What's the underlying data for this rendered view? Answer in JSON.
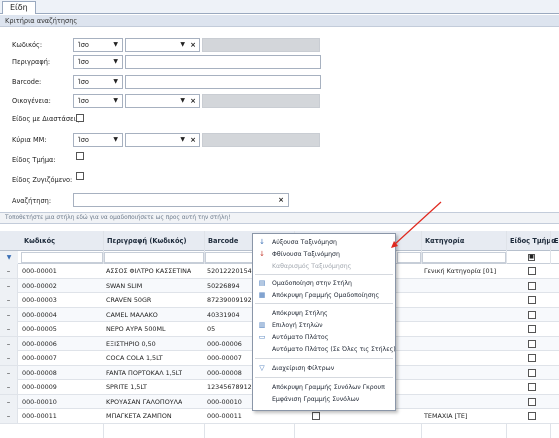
{
  "tab": {
    "label": "Είδη"
  },
  "criteria": {
    "header": "Κριτήρια αναζήτησης",
    "code_label": "Κωδικός:",
    "code_op": "Ίσο",
    "desc_label": "Περιγραφή:",
    "desc_op": "Ίσο",
    "barcode_label": "Barcode:",
    "barcode_op": "Ίσο",
    "family_label": "Οικογένεια:",
    "family_op": "Ίσο",
    "dimensions_label": "Είδος με Διαστάσεις:",
    "unit_label": "Κύρια ΜΜ:",
    "unit_op": "Ίσο",
    "part_label": "Είδος Τμήμα:",
    "weighed_label": "Είδος Ζυγιζόμενο:",
    "search_label": "Αναζήτηση:",
    "search_value": ""
  },
  "grid": {
    "group_hint": "Τοποθετήστε μια στήλη εδώ για να ομαδοποιήσετε ως προς αυτή την στήλη!",
    "columns": [
      "Κωδικός",
      "Περιγραφή (Κωδικός)",
      "Barcode",
      "",
      "Κατηγορία",
      "Είδος Τμήμα",
      "Ε"
    ],
    "rows": [
      {
        "code": "000-00001",
        "desc": "ΑΣΣΟΣ ΦΙΛΤΡΟ ΚΑΣΣΕΤΙΝΑ",
        "barcode": "5201222015413",
        "cat": "Γενική Κατηγορία [01]"
      },
      {
        "code": "000-00002",
        "desc": "SWAN SLIM",
        "barcode": "50226894",
        "cat": ""
      },
      {
        "code": "000-00003",
        "desc": "CRAVEN 50GR",
        "barcode": "8723900919259",
        "cat": ""
      },
      {
        "code": "000-00004",
        "desc": "CAMEL ΜΑΛΑΚΟ",
        "barcode": "40331904",
        "cat": ""
      },
      {
        "code": "000-00005",
        "desc": "ΝΕΡΟ ΑΥΡΑ 500ML",
        "barcode": "05",
        "cat": ""
      },
      {
        "code": "000-00006",
        "desc": "ΕΞΙΣΤΗΡΙΟ 0,50",
        "barcode": "000-00006",
        "cat": ""
      },
      {
        "code": "000-00007",
        "desc": "COCA COLA 1,5LT",
        "barcode": "000-00007",
        "cat": ""
      },
      {
        "code": "000-00008",
        "desc": "FANTA ΠΟΡΤΟΚΑΛ 1,5LT",
        "barcode": "000-00008",
        "cat": ""
      },
      {
        "code": "000-00009",
        "desc": "SPRITE 1,5LT",
        "barcode": "123456789128",
        "cat": ""
      },
      {
        "code": "000-00010",
        "desc": "ΚΡΟΥΑΣΑΝ ΓΑΛΟΠΟΥΛΑ",
        "barcode": "000-00010",
        "cat": ""
      },
      {
        "code": "000-00011",
        "desc": "ΜΠΑΓΚΕΤΑ ΖΑΜΠΟΝ",
        "barcode": "000-00011",
        "cat": "ΤΕΜΑΧΙΑ [ΤΕ]"
      }
    ]
  },
  "context_menu": {
    "sort_asc": "Αύξουσα Ταξινόμηση",
    "sort_desc": "Φθίνουσα Ταξινόμηση",
    "clear_sort": "Καθαρισμός Ταξινόμησης",
    "group_by": "Ομαδοποίηση στην Στήλη",
    "hide_group_row": "Απόκρυψη Γραμμής Ομαδοποίησης",
    "hide_column": "Απόκρυψη Στήλης",
    "choose_columns": "Επιλογή Στηλών",
    "auto_width": "Αυτόματο Πλάτος",
    "auto_width_all": "Αυτόματο Πλάτος (Σε Όλες τις Στήλες)",
    "filter_manage": "Διαχείριση Φίλτρων",
    "hide_group_totals": "Απόκρυψη Γραμμής Συνόλων Γκρουπ",
    "show_totals": "Εμφάνιση Γραμμής Συνόλων"
  },
  "colors": {
    "arrow": "#e0281e",
    "header_bg": "#e7ebf2",
    "accent": "#3a6fb5"
  }
}
